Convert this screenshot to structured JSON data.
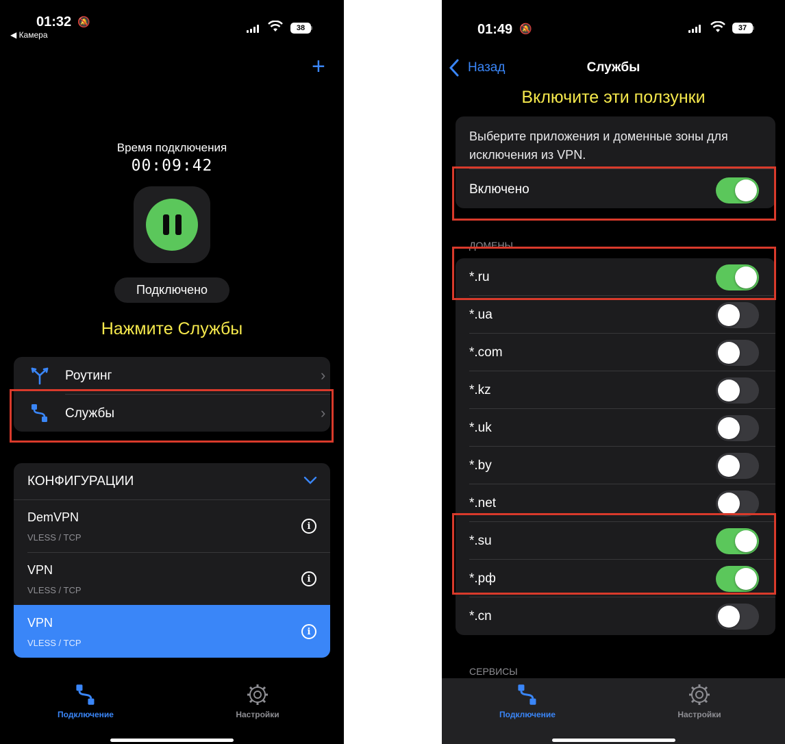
{
  "left": {
    "status": {
      "time": "01:32",
      "back_app": "◀ Камера",
      "battery": "38"
    },
    "add_label": "+",
    "timer": {
      "label": "Время подключения",
      "value": "00:09:42"
    },
    "status_pill": "Подключено",
    "hint": "Нажмите Службы",
    "menu": [
      {
        "label": "Роутинг",
        "icon": "routing-icon"
      },
      {
        "label": "Службы",
        "icon": "services-icon"
      }
    ],
    "configs": {
      "header": "КОНФИГУРАЦИИ",
      "items": [
        {
          "name": "DemVPN",
          "protocol": "VLESS / TCP",
          "selected": false
        },
        {
          "name": "VPN",
          "protocol": "VLESS / TCP",
          "selected": false
        },
        {
          "name": "VPN",
          "protocol": "VLESS / TCP",
          "selected": true
        }
      ]
    },
    "tabbar": {
      "connection": "Подключение",
      "settings": "Настройки"
    },
    "colors": {
      "accent": "#3a86f8",
      "green": "#5bc75b",
      "highlight": "#d93a2b",
      "hint": "#f5e84c"
    }
  },
  "right": {
    "status": {
      "time": "01:49",
      "battery": "37"
    },
    "nav": {
      "back": "Назад",
      "title": "Службы"
    },
    "hint": "Включите эти ползунки",
    "description": "Выберите приложения и доменные зоны для исключения из VPN.",
    "enabled": {
      "label": "Включено",
      "on": true
    },
    "domains_header": "ДОМЕНЫ",
    "domains": [
      {
        "label": "*.ru",
        "on": true
      },
      {
        "label": "*.ua",
        "on": false
      },
      {
        "label": "*.com",
        "on": false
      },
      {
        "label": "*.kz",
        "on": false
      },
      {
        "label": "*.uk",
        "on": false
      },
      {
        "label": "*.by",
        "on": false
      },
      {
        "label": "*.net",
        "on": false
      },
      {
        "label": "*.su",
        "on": true
      },
      {
        "label": "*.рф",
        "on": true
      },
      {
        "label": "*.cn",
        "on": false
      }
    ],
    "services_header": "СЕРВИСЫ",
    "tabbar": {
      "connection": "Подключение",
      "settings": "Настройки"
    }
  }
}
